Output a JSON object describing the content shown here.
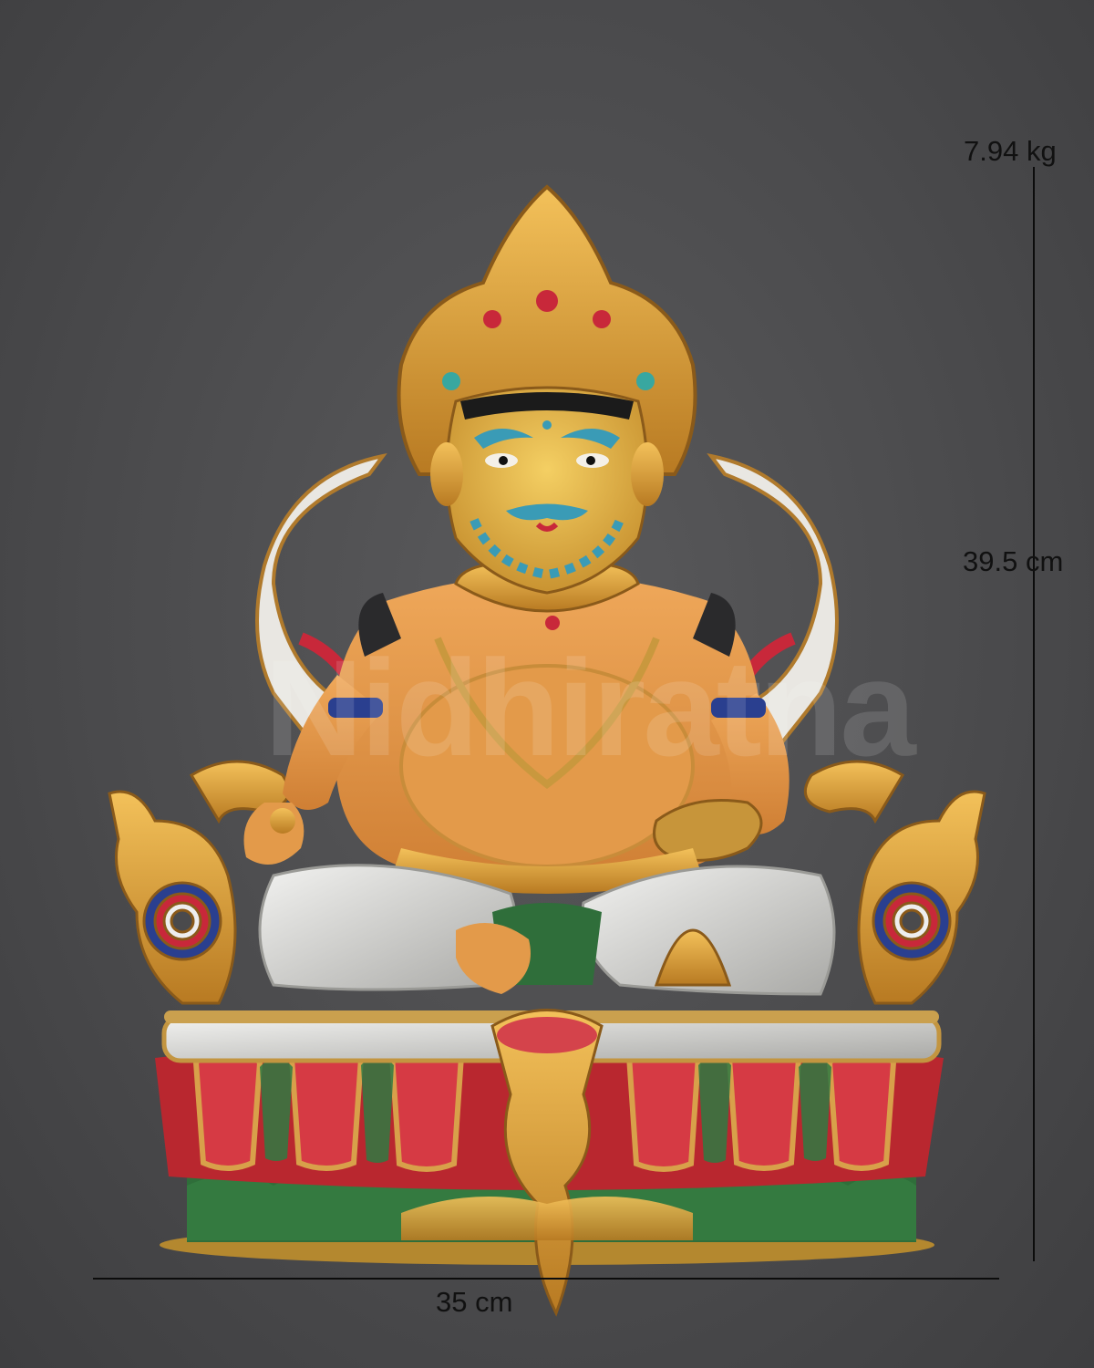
{
  "dimensions": {
    "weight": "7.94 kg",
    "height": "39.5 cm",
    "width": "35 cm"
  },
  "watermark": "Nidhiratna",
  "colors": {
    "background": "#4a4a4c",
    "gold": "#d9a23a",
    "skin": "#e39a4a",
    "lotus_red": "#c8283a",
    "lotus_green": "#2f6e3a",
    "silver": "#d6d6d4",
    "turquoise": "#38a7a0",
    "blue": "#2a3f8f"
  }
}
